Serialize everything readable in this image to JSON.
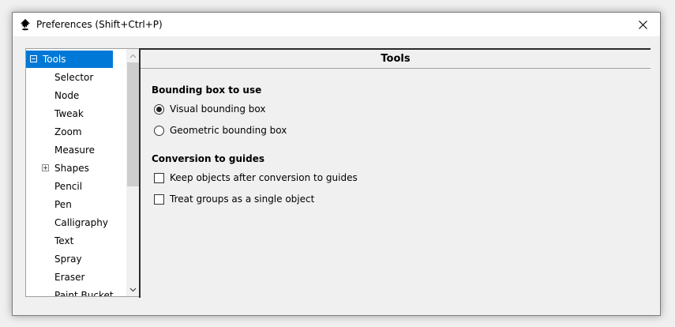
{
  "window": {
    "title": "Preferences (Shift+Ctrl+P)",
    "close_icon": "close-icon",
    "app_icon": "inkscape-logo-icon"
  },
  "sidebar": {
    "items": [
      {
        "label": "Tools",
        "expander": "minus",
        "selected": true
      },
      {
        "label": "Selector"
      },
      {
        "label": "Node"
      },
      {
        "label": "Tweak"
      },
      {
        "label": "Zoom"
      },
      {
        "label": "Measure"
      },
      {
        "label": "Shapes",
        "expander": "plus"
      },
      {
        "label": "Pencil"
      },
      {
        "label": "Pen"
      },
      {
        "label": "Calligraphy"
      },
      {
        "label": "Text"
      },
      {
        "label": "Spray"
      },
      {
        "label": "Eraser"
      },
      {
        "label": "Paint Bucket"
      }
    ]
  },
  "panel": {
    "title": "Tools",
    "bbox_section": {
      "title": "Bounding box to use",
      "options": [
        {
          "label": "Visual bounding box",
          "checked": true
        },
        {
          "label": "Geometric bounding box",
          "checked": false
        }
      ]
    },
    "guides_section": {
      "title": "Conversion to guides",
      "options": [
        {
          "label": "Keep objects after conversion to guides",
          "checked": false
        },
        {
          "label": "Treat groups as a single object",
          "checked": false
        }
      ]
    }
  },
  "colors": {
    "selection": "#0078d7",
    "background": "#f0f0f0"
  }
}
